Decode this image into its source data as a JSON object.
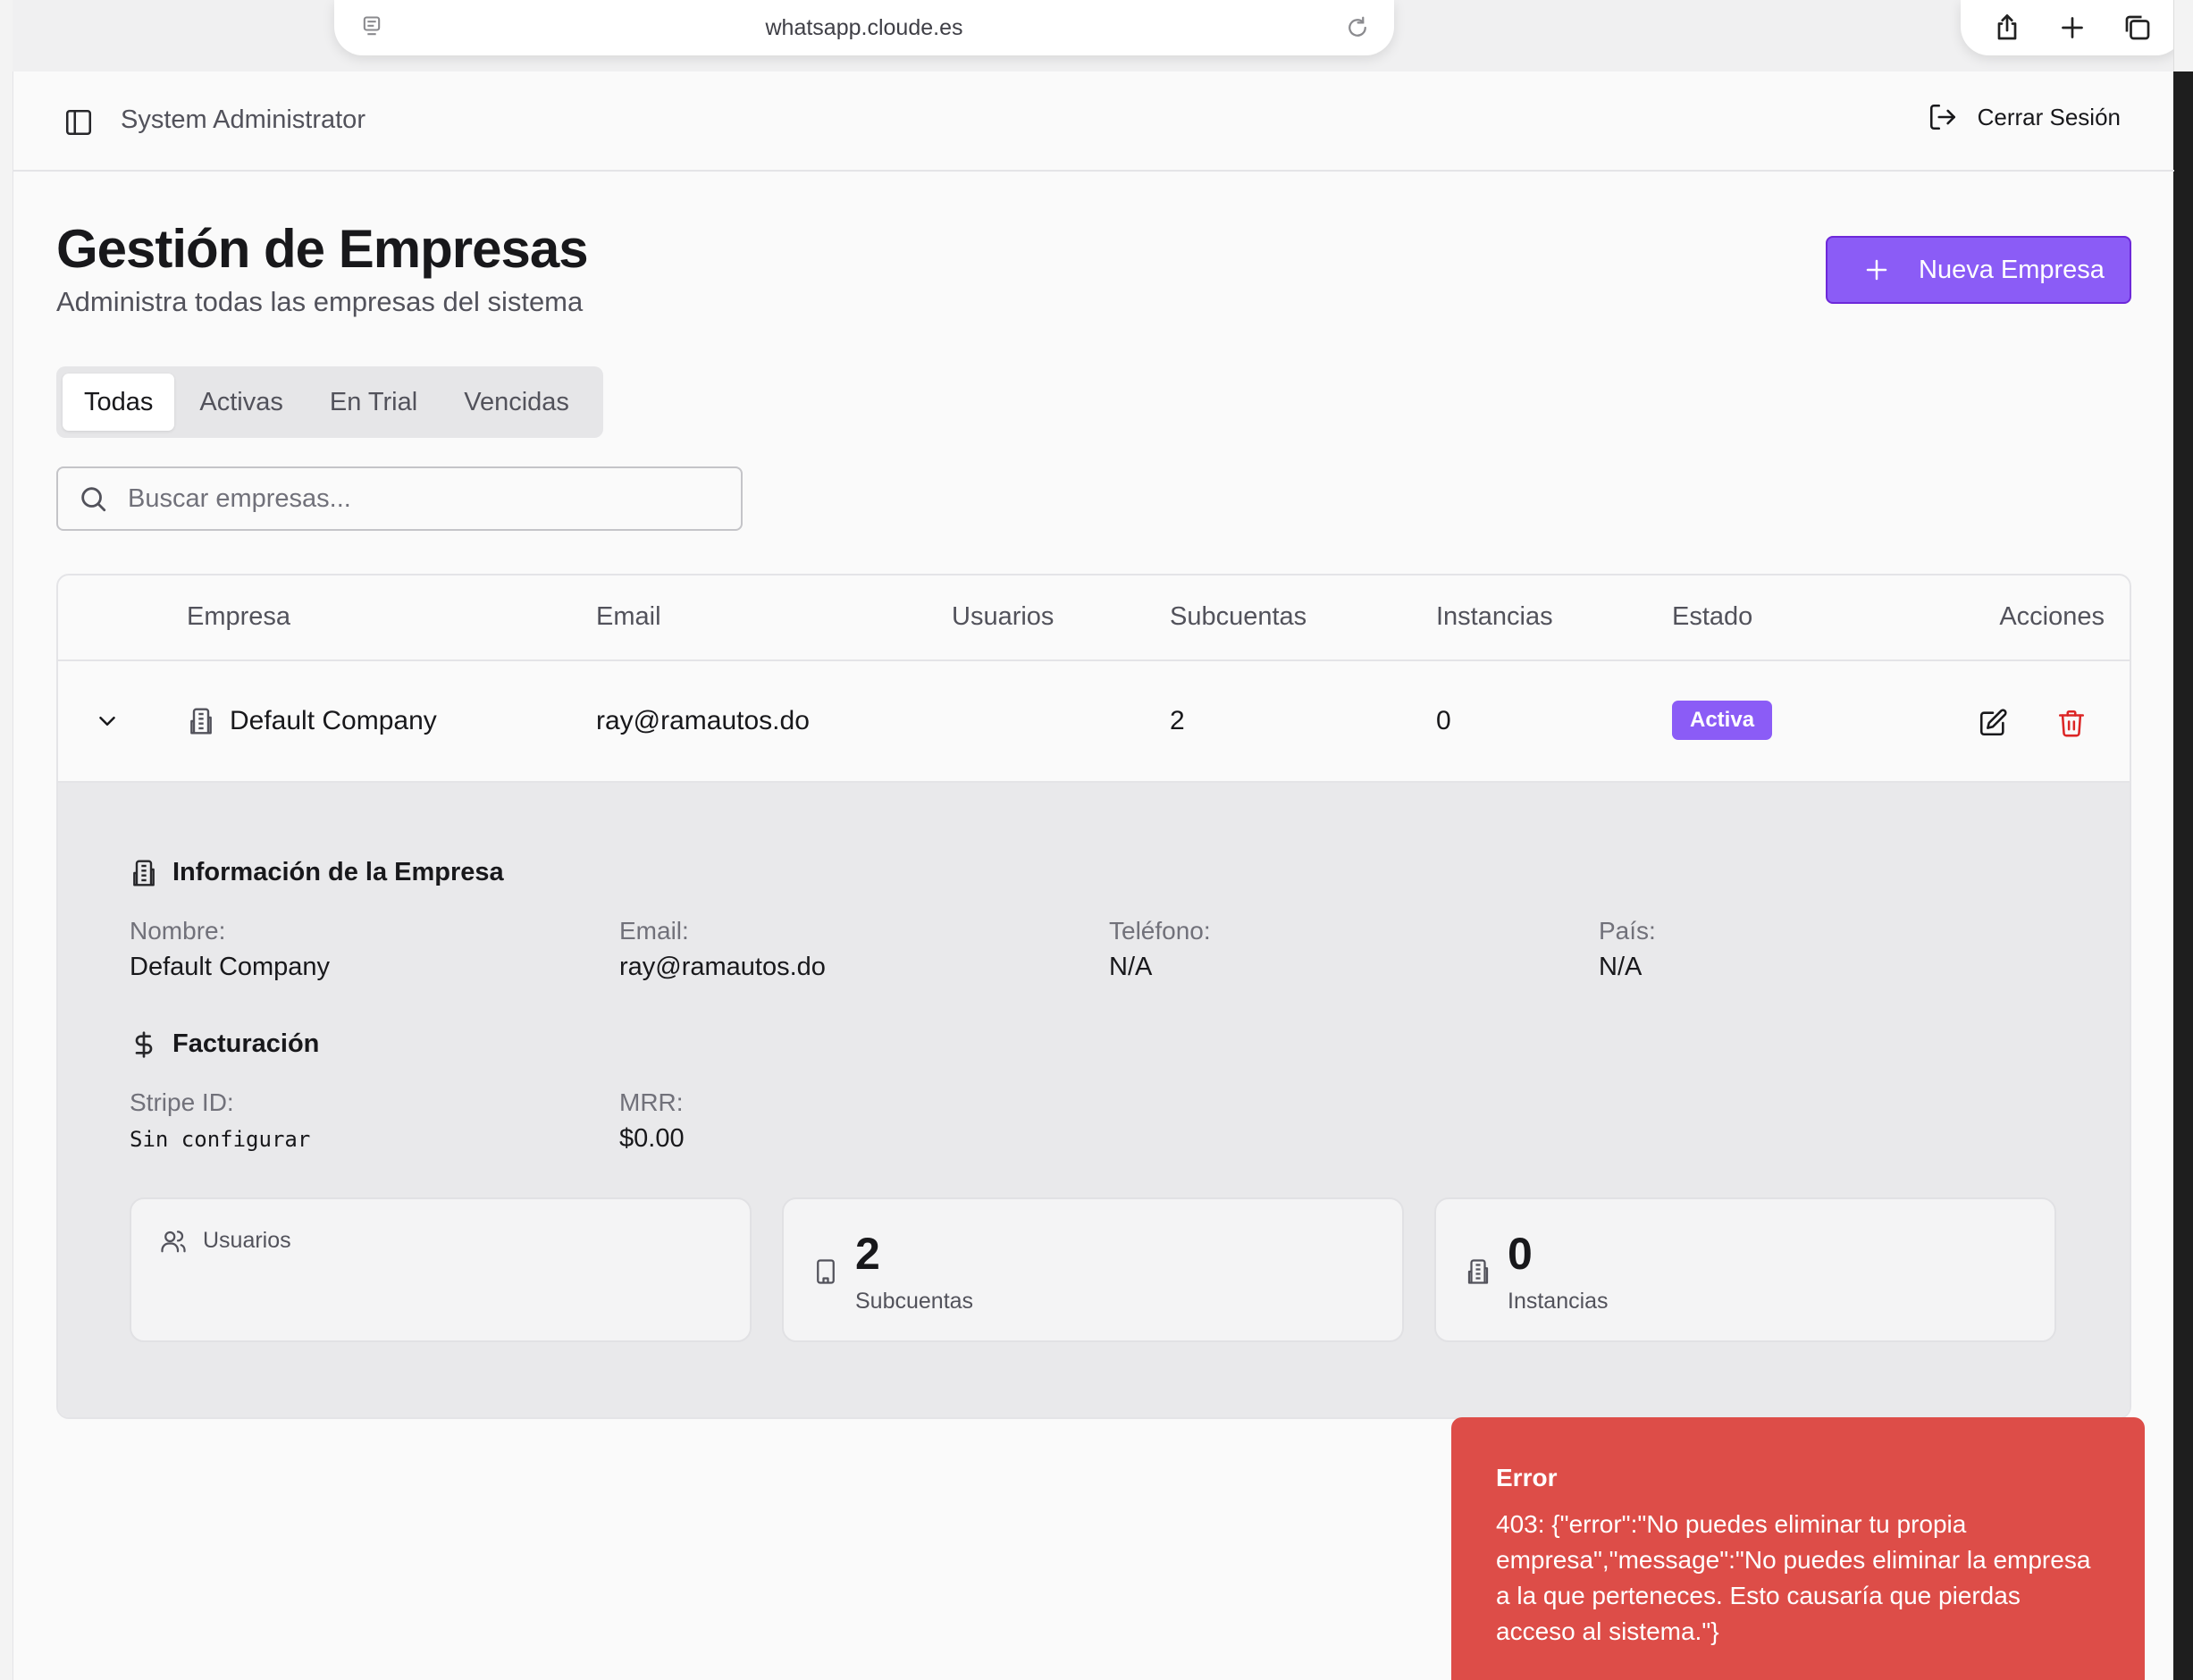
{
  "browser": {
    "url": "whatsapp.cloude.es"
  },
  "header": {
    "user_name": "System Administrator",
    "logout_label": "Cerrar Sesión"
  },
  "page": {
    "title": "Gestión de Empresas",
    "subtitle": "Administra todas las empresas del sistema",
    "new_button_label": "Nueva Empresa"
  },
  "tabs": [
    {
      "label": "Todas",
      "active": true
    },
    {
      "label": "Activas",
      "active": false
    },
    {
      "label": "En Trial",
      "active": false
    },
    {
      "label": "Vencidas",
      "active": false
    }
  ],
  "search": {
    "placeholder": "Buscar empresas..."
  },
  "table": {
    "columns": [
      "Empresa",
      "Email",
      "Usuarios",
      "Subcuentas",
      "Instancias",
      "Estado",
      "Acciones"
    ],
    "rows": [
      {
        "empresa": "Default Company",
        "email": "ray@ramautos.do",
        "usuarios": "",
        "subcuentas": "2",
        "instancias": "0",
        "estado": "Activa"
      }
    ]
  },
  "details": {
    "info_title": "Información de la Empresa",
    "nombre_label": "Nombre:",
    "nombre_value": "Default Company",
    "email_label": "Email:",
    "email_value": "ray@ramautos.do",
    "telefono_label": "Teléfono:",
    "telefono_value": "N/A",
    "pais_label": "País:",
    "pais_value": "N/A",
    "billing_title": "Facturación",
    "stripe_label": "Stripe ID:",
    "stripe_value": "Sin configurar",
    "mrr_label": "MRR:",
    "mrr_value": "$0.00",
    "stats": [
      {
        "label": "Usuarios",
        "value": ""
      },
      {
        "label": "Subcuentas",
        "value": "2"
      },
      {
        "label": "Instancias",
        "value": "0"
      }
    ]
  },
  "toast": {
    "title": "Error",
    "message": "403: {\"error\":\"No puedes eliminar tu propia empresa\",\"message\":\"No puedes eliminar la empresa a la que perteneces. Esto causaría que pierdas acceso al sistema.\"}"
  },
  "colors": {
    "accent": "#8b5cf6",
    "danger": "#dd4d48",
    "delete_icon": "#dc2626"
  }
}
